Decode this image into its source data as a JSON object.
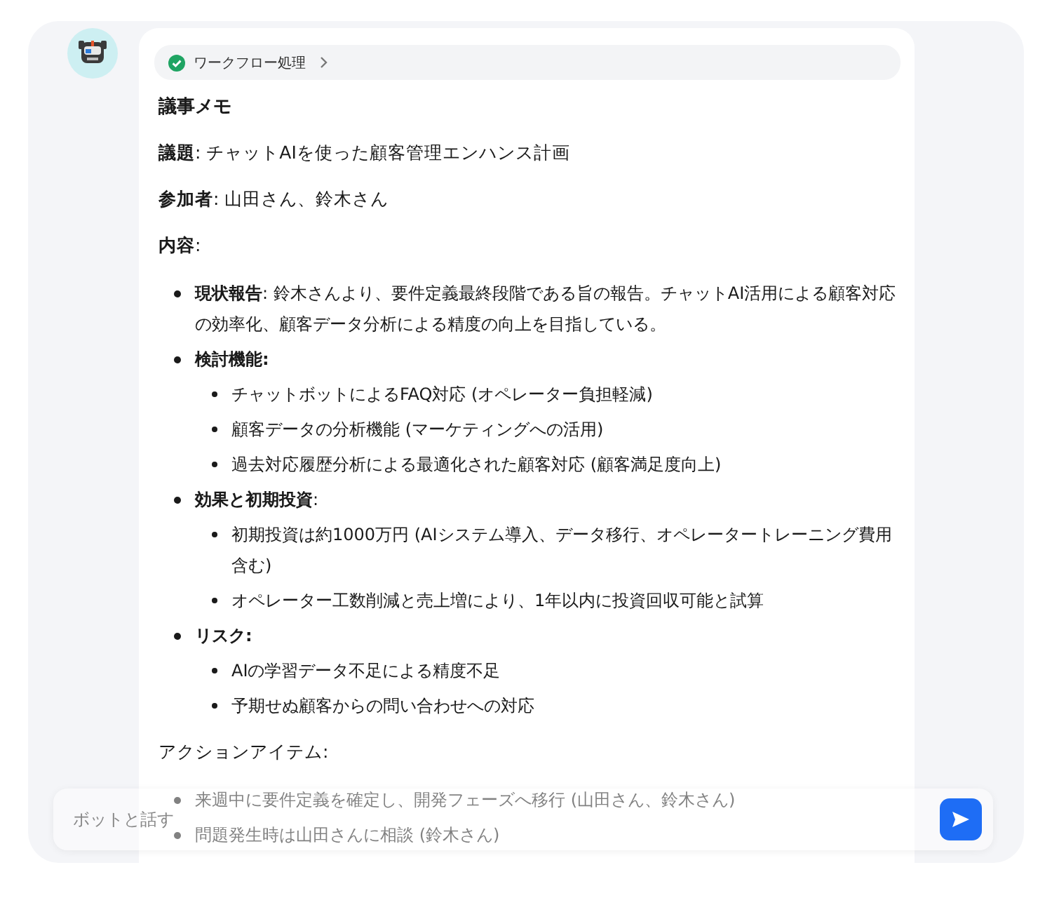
{
  "chip": {
    "label": "ワークフロー処理",
    "done": true
  },
  "title": "議事メモ",
  "fields": [
    "**議題**: チャットAIを使った顧客管理エンハンス計画",
    "**参加者**: 山田さん、鈴木さん"
  ],
  "content_heading": "**内容**:",
  "items": [
    {
      "text": "**現状報告**: 鈴木さんより、要件定義最終段階である旨の報告。チャットAI活用による顧客対応の効率化、顧客データ分析による精度の向上を目指している。"
    },
    {
      "text": "**検討機能:**",
      "children": [
        "チャットボットによるFAQ対応 (オペレーター負担軽減)",
        "顧客データの分析機能 (マーケティングへの活用)",
        "過去対応履歴分析による最適化された顧客対応 (顧客満足度向上)"
      ]
    },
    {
      "text": "**効果と初期投資**:",
      "children": [
        "初期投資は約1000万円 (AIシステム導入、データ移行、オペレータートレーニング費用含む)",
        "オペレーター工数削減と売上増により、1年以内に投資回収可能と試算"
      ]
    },
    {
      "text": "**リスク:**",
      "children": [
        "AIの学習データ不足による精度不足",
        "予期せぬ顧客からの問い合わせへの対応"
      ]
    }
  ],
  "action_heading": "アクションアイテム:",
  "actions": [
    "来週中に要件定義を確定し、開発フェーズへ移行 (山田さん、鈴木さん)",
    "問題発生時は山田さんに相談 (鈴木さん)"
  ],
  "input": {
    "placeholder": "ボットと話す"
  }
}
